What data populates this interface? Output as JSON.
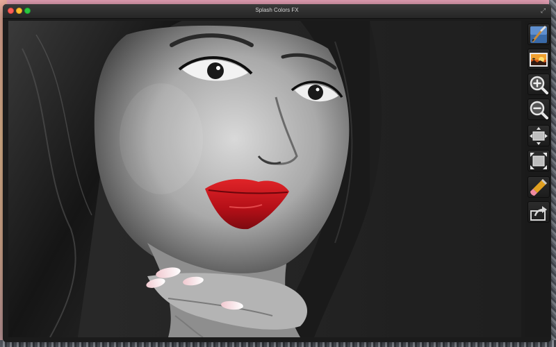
{
  "window": {
    "title": "Splash Colors FX"
  },
  "titlebar_controls": {
    "fullscreen_glyph": "⤢"
  },
  "canvas": {
    "content": "photo"
  },
  "toolbar": {
    "tools": [
      {
        "name": "brush",
        "icon": "paintbrush-icon"
      },
      {
        "name": "image",
        "icon": "sunset-photo-icon"
      },
      {
        "name": "zoom-in",
        "icon": "zoom-in-icon"
      },
      {
        "name": "zoom-out",
        "icon": "zoom-out-icon"
      },
      {
        "name": "fit",
        "icon": "fit-to-window-icon"
      },
      {
        "name": "fullsize",
        "icon": "actual-size-icon"
      },
      {
        "name": "eraser",
        "icon": "eraser-icon"
      },
      {
        "name": "share",
        "icon": "share-icon"
      }
    ]
  },
  "colors": {
    "accent_red": "#d8141e",
    "window_bg": "#1b1b1b"
  }
}
